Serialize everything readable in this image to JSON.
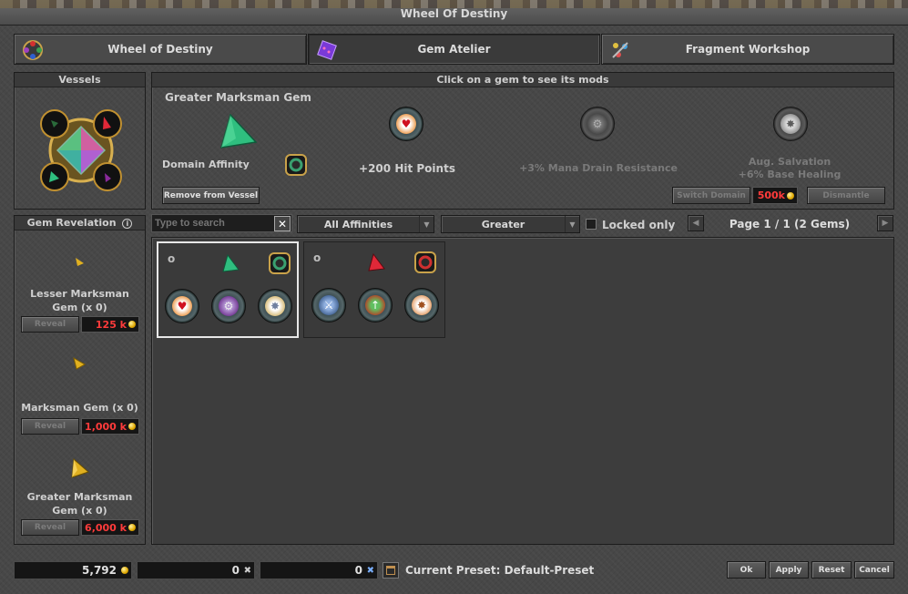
{
  "window": {
    "title": "Wheel Of Destiny"
  },
  "tabs": [
    {
      "label": "Wheel of Destiny",
      "icon": "wheel-icon"
    },
    {
      "label": "Gem Atelier",
      "icon": "gem-atelier-icon"
    },
    {
      "label": "Fragment Workshop",
      "icon": "fragment-workshop-icon"
    }
  ],
  "vessels": {
    "title": "Vessels"
  },
  "mods_panel": {
    "hint": "Click on a gem to see its mods",
    "gem_name": "Greater Marksman Gem",
    "domain_label": "Domain Affinity",
    "remove_button": "Remove from Vessel",
    "mods": [
      {
        "text": "+200 Hit Points",
        "active": true
      },
      {
        "text": "+3% Mana Drain Resistance",
        "active": false
      },
      {
        "text": "Aug. Salvation",
        "text2": "+6% Base Healing",
        "active": false
      }
    ],
    "switch_domain_button": "Switch Domain",
    "switch_domain_price": "500k",
    "dismantle_button": "Dismantle"
  },
  "revelation": {
    "title": "Gem Revelation",
    "items": [
      {
        "name_line1": "Lesser Marksman",
        "name_line2": "Gem (x 0)",
        "button": "Reveal",
        "price": "125 k"
      },
      {
        "name_line1": "Marksman Gem (x 0)",
        "name_line2": "",
        "button": "Reveal",
        "price": "1,000 k"
      },
      {
        "name_line1": "Greater Marksman",
        "name_line2": "Gem (x 0)",
        "button": "Reveal",
        "price": "6,000 k"
      }
    ]
  },
  "filters": {
    "search_placeholder": "Type to search",
    "affinity": "All Affinities",
    "quality": "Greater",
    "locked_label": "Locked only",
    "page_text": "Page 1 / 1 (2 Gems)"
  },
  "gems": [
    {
      "color": "green",
      "selected": true
    },
    {
      "color": "red",
      "selected": false
    }
  ],
  "footer": {
    "gold": "5,792",
    "fragments_lesser": "0",
    "fragments_greater": "0",
    "preset_label": "Current Preset: Default-Preset",
    "buttons": {
      "ok": "Ok",
      "apply": "Apply",
      "reset": "Reset",
      "cancel": "Cancel"
    }
  },
  "colors": {
    "price_red": "#ff3b3b",
    "gem_green": "#2fbf7f",
    "gem_red": "#e02838",
    "gem_gold": "#e0b020"
  }
}
